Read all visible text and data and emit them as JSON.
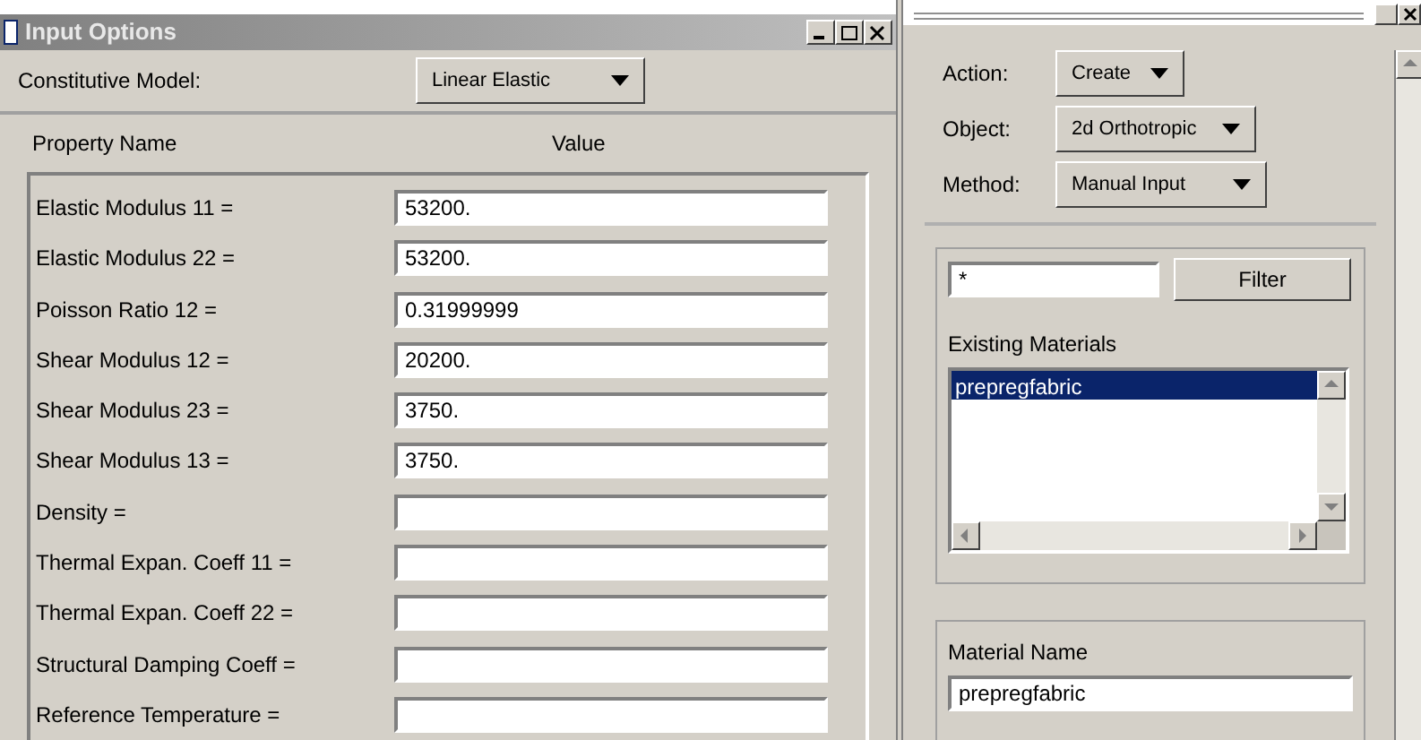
{
  "window": {
    "title": "Input Options"
  },
  "constitutive_model": {
    "label": "Constitutive Model:",
    "value": "Linear Elastic"
  },
  "table": {
    "columns": [
      "Property Name",
      "Value"
    ],
    "rows": [
      {
        "name": "Elastic Modulus 11 =",
        "value": "53200."
      },
      {
        "name": "Elastic Modulus 22 =",
        "value": "53200."
      },
      {
        "name": "Poisson Ratio 12 =",
        "value": "0.31999999"
      },
      {
        "name": "Shear Modulus 12 =",
        "value": "20200."
      },
      {
        "name": "Shear Modulus 23 =",
        "value": "3750."
      },
      {
        "name": "Shear Modulus 13 =",
        "value": "3750."
      },
      {
        "name": "Density =",
        "value": ""
      },
      {
        "name": "Thermal Expan. Coeff 11 =",
        "value": ""
      },
      {
        "name": "Thermal Expan. Coeff 22 =",
        "value": ""
      },
      {
        "name": "Structural Damping Coeff =",
        "value": ""
      },
      {
        "name": "Reference Temperature =",
        "value": ""
      }
    ]
  },
  "side_panel": {
    "selectors": [
      {
        "label": "Action:",
        "value": "Create"
      },
      {
        "label": "Object:",
        "value": "2d Orthotropic"
      },
      {
        "label": "Method:",
        "value": "Manual Input"
      }
    ],
    "filter": {
      "value": "*",
      "button": "Filter"
    },
    "existing_materials": {
      "label": "Existing Materials",
      "items": [
        {
          "name": "prepregfabric",
          "selected": true
        }
      ]
    },
    "material_name": {
      "label": "Material Name",
      "value": "prepregfabric"
    }
  }
}
